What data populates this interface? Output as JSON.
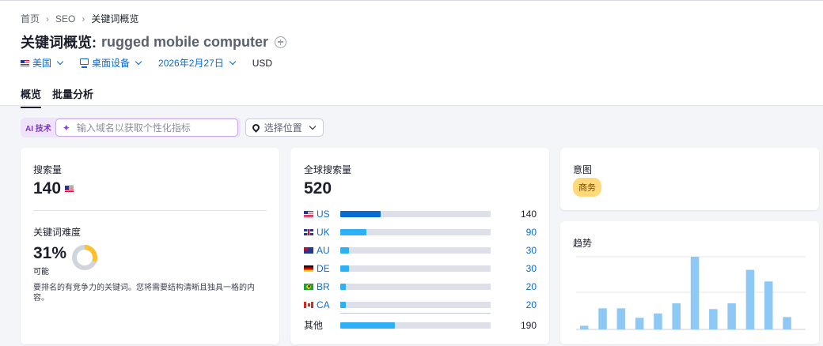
{
  "breadcrumb": {
    "home": "首页",
    "section": "SEO",
    "current": "关键词概览"
  },
  "title": {
    "prefix": "关键词概览:",
    "keyword": "rugged mobile computer"
  },
  "filters": {
    "country": "美国",
    "device": "桌面设备",
    "date": "2026年2月27日",
    "currency": "USD"
  },
  "tabs": [
    {
      "label": "概览",
      "active": true
    },
    {
      "label": "批量分析",
      "active": false
    }
  ],
  "ai": {
    "badge": "AI 技术",
    "placeholder": "输入域名以获取个性化指标",
    "location_button": "选择位置"
  },
  "volume": {
    "label": "搜索量",
    "value": "140"
  },
  "difficulty": {
    "label": "关键词难度",
    "value": "31%",
    "percent": 31,
    "level": "可能",
    "description": "要排名的有竞争力的关键词。您将需要结构清晰且独具一格的内容。",
    "color": "#ffc02e"
  },
  "global_volume": {
    "label": "全球搜索量",
    "value": "520",
    "max": 520,
    "countries": [
      {
        "code": "US",
        "value": 140,
        "display": "140"
      },
      {
        "code": "UK",
        "value": 90,
        "display": "90"
      },
      {
        "code": "AU",
        "value": 30,
        "display": "30"
      },
      {
        "code": "DE",
        "value": 30,
        "display": "30"
      },
      {
        "code": "BR",
        "value": 20,
        "display": "20"
      },
      {
        "code": "CA",
        "value": 20,
        "display": "20"
      }
    ],
    "other": {
      "label": "其他",
      "value": 190,
      "display": "190"
    }
  },
  "intent": {
    "label": "意图",
    "badge": "商务"
  },
  "trend": {
    "label": "趋势",
    "chart_data": {
      "type": "bar",
      "values": [
        0.05,
        0.29,
        0.29,
        0.16,
        0.22,
        0.36,
        1.0,
        0.28,
        0.36,
        0.82,
        0.66,
        0.17
      ],
      "ylim": [
        0,
        1
      ],
      "grid": true,
      "color": "#8ec8f4"
    }
  },
  "colors": {
    "accent": "#0a6ad1",
    "bar_light": "#2eb0f7",
    "track": "#dde0e8"
  }
}
